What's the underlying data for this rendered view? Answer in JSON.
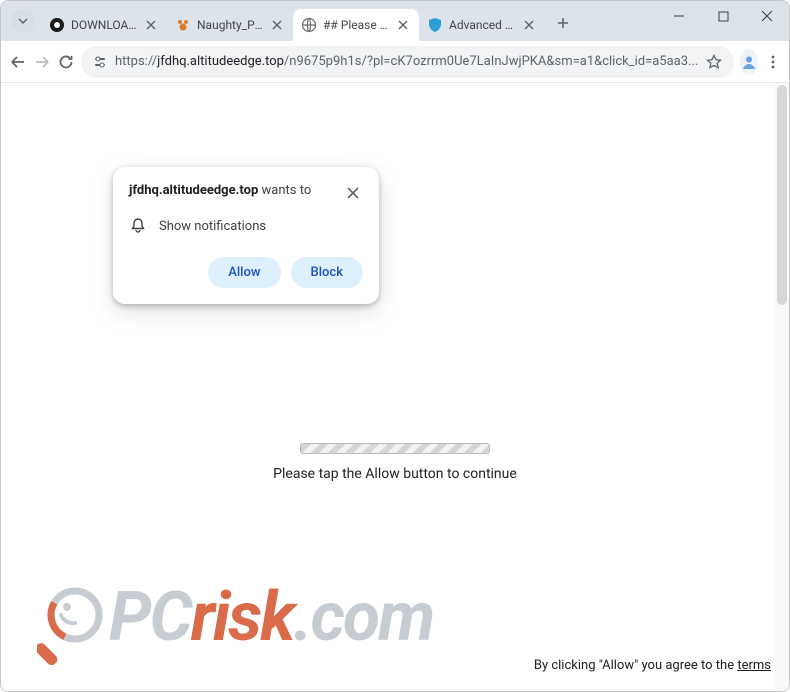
{
  "tabs": [
    {
      "title": "DOWNLOAD: Red",
      "favicon": "circle-dark"
    },
    {
      "title": "Naughty_Popa's F",
      "favicon": "paw-orange"
    },
    {
      "title": "## Please tap the",
      "favicon": "globe",
      "active": true
    },
    {
      "title": "Advanced Ad Blo",
      "favicon": "shield-blue"
    }
  ],
  "nav": {
    "url_proto": "https://",
    "url_host": "jfdhq.altitudeedge.top",
    "url_path": "/n9675p9h1s/?pl=cK7ozrrm0Ue7LaInJwjPKA&sm=a1&click_id=a5aa3..."
  },
  "permission_prompt": {
    "domain": "jfdhq.altitudeedge.top",
    "wants_to": " wants to",
    "show_notifications": "Show notifications",
    "allow": "Allow",
    "block": "Block"
  },
  "page": {
    "progress_text": "Please tap the Allow button to continue"
  },
  "footer": {
    "pre": "By clicking \"Allow\" you agree to the ",
    "terms": "terms"
  },
  "logo": {
    "pc": "PC",
    "risk": "risk",
    "dot": ".com"
  }
}
